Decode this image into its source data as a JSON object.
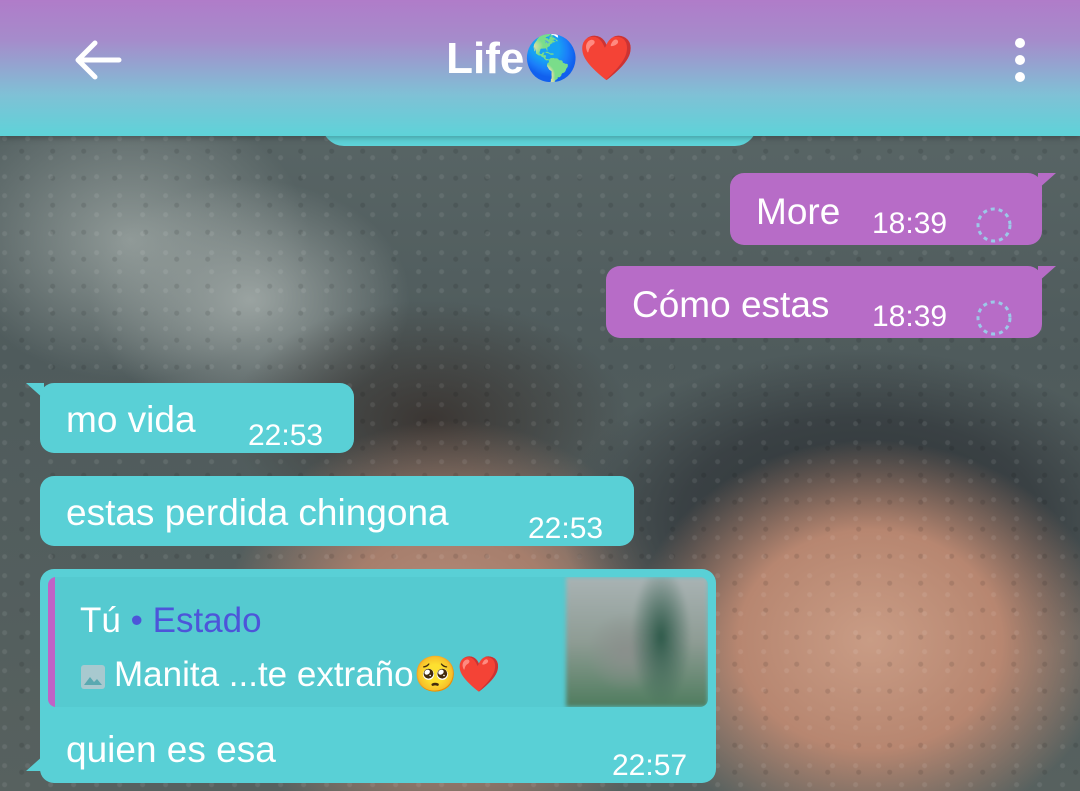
{
  "header": {
    "title": "Life🌎❤️",
    "back_icon": "arrow-left-icon",
    "menu_icon": "more-vertical-icon"
  },
  "colors": {
    "appbar_top": "#b07cc9",
    "appbar_bottom": "#5ed3d8",
    "outgoing_bubble": "#b76cc7",
    "incoming_bubble": "#59d0d6",
    "quote_accent": "#c062c6",
    "quote_status": "#4d55d9"
  },
  "messages": [
    {
      "direction": "outgoing",
      "text": "More",
      "time": "18:39",
      "status_icon": "pending-clock-icon"
    },
    {
      "direction": "outgoing",
      "text": "Cómo estas",
      "time": "18:39",
      "status_icon": "pending-clock-icon"
    },
    {
      "direction": "incoming",
      "text": "mo vida",
      "time": "22:53"
    },
    {
      "direction": "incoming",
      "text": "estas perdida chingona",
      "time": "22:53"
    },
    {
      "direction": "incoming",
      "text": "quien es esa",
      "time": "22:57",
      "reply": {
        "author": "Tú",
        "separator": "•",
        "context": "Estado",
        "media_icon": "image-icon",
        "text": "Manita ...te extraño🥺❤️"
      }
    }
  ]
}
